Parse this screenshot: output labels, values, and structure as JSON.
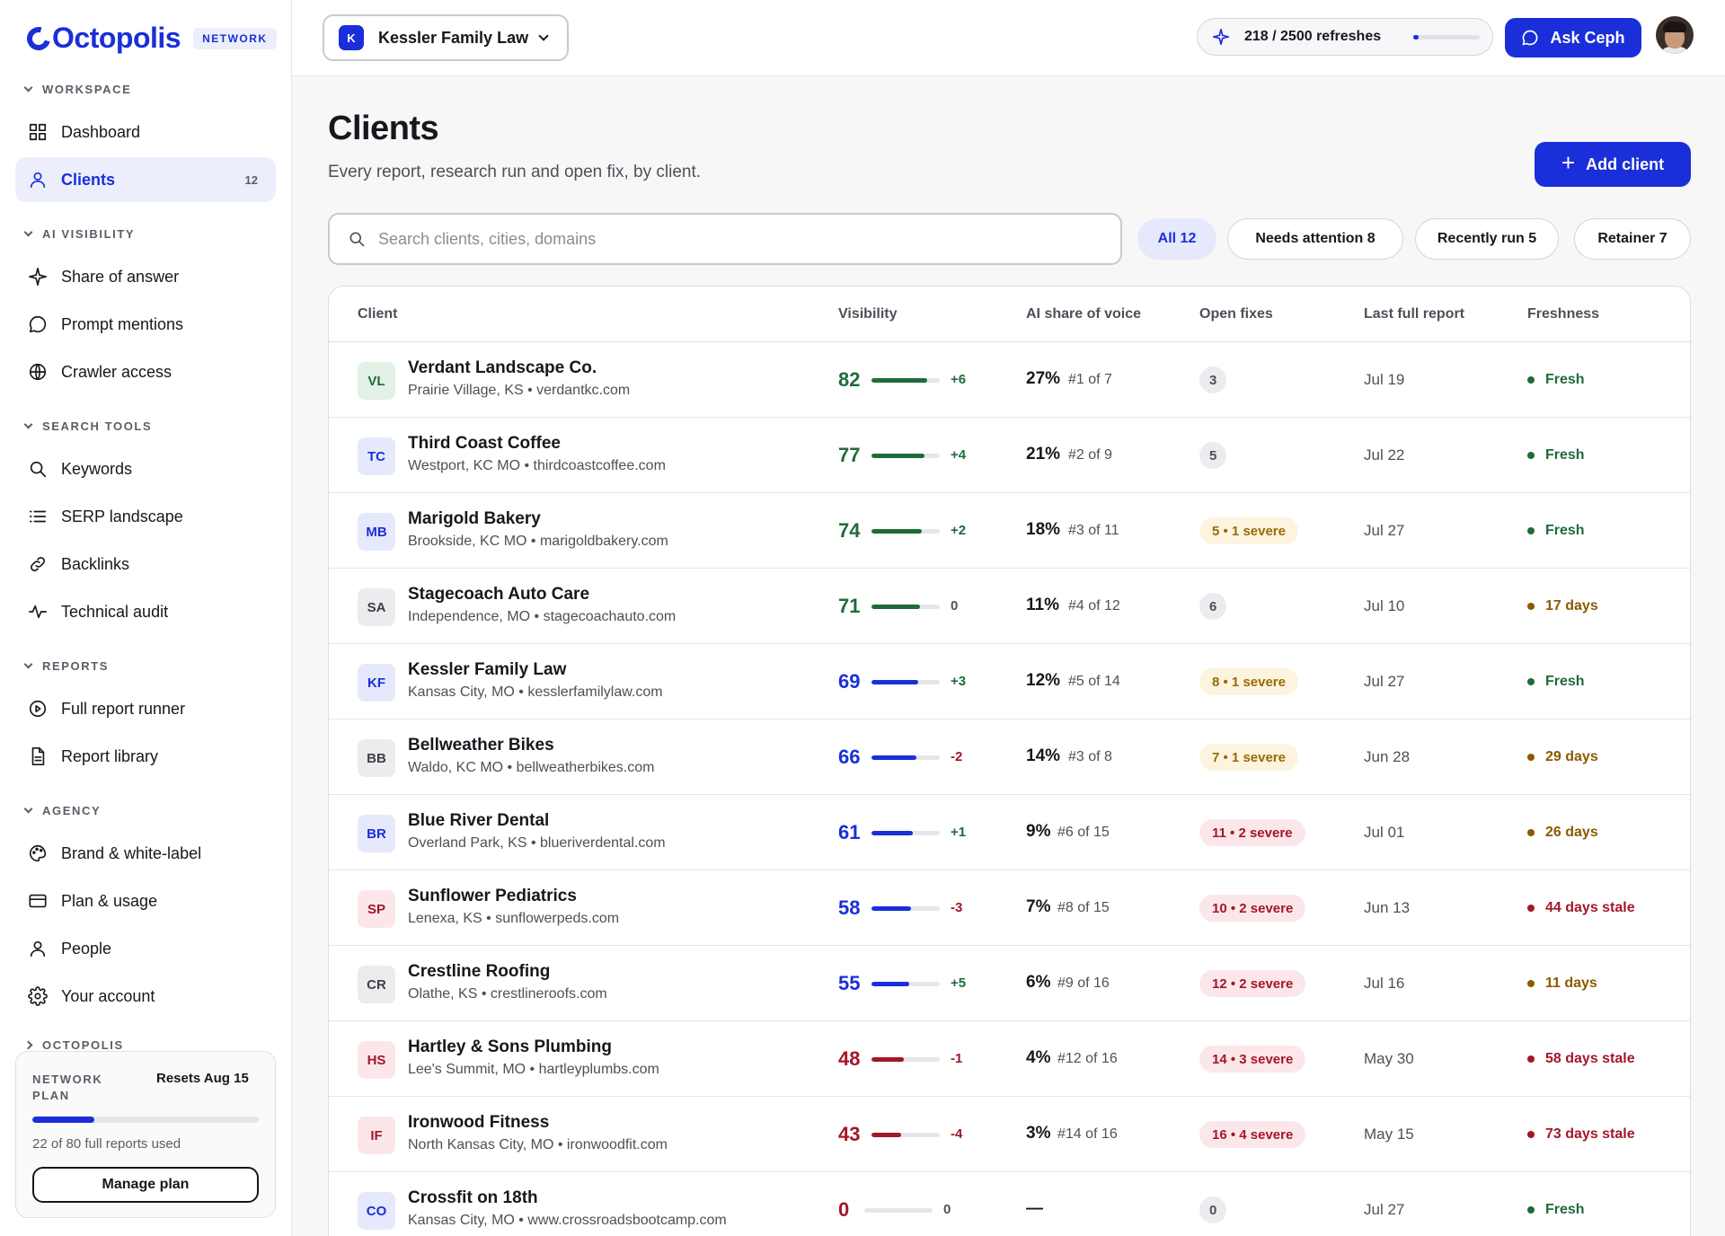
{
  "app": {
    "name": "Octopolis",
    "plan_badge": "NETWORK"
  },
  "sidebar": {
    "sections": [
      {
        "label": "WORKSPACE",
        "items": [
          {
            "label": "Dashboard",
            "icon": "grid-icon"
          },
          {
            "label": "Clients",
            "icon": "user-icon",
            "count": "12",
            "active": true
          }
        ]
      },
      {
        "label": "AI VISIBILITY",
        "items": [
          {
            "label": "Share of answer",
            "icon": "sparkle-icon"
          },
          {
            "label": "Prompt mentions",
            "icon": "chat-bubble-icon"
          },
          {
            "label": "Crawler access",
            "icon": "globe-icon"
          }
        ]
      },
      {
        "label": "SEARCH TOOLS",
        "items": [
          {
            "label": "Keywords",
            "icon": "search-icon"
          },
          {
            "label": "SERP landscape",
            "icon": "list-icon"
          },
          {
            "label": "Backlinks",
            "icon": "link-icon"
          },
          {
            "label": "Technical audit",
            "icon": "pulse-icon"
          }
        ]
      },
      {
        "label": "REPORTS",
        "items": [
          {
            "label": "Full report runner",
            "icon": "play-circle-icon"
          },
          {
            "label": "Report library",
            "icon": "document-icon"
          }
        ]
      },
      {
        "label": "AGENCY",
        "items": [
          {
            "label": "Brand & white-label",
            "icon": "palette-icon"
          },
          {
            "label": "Plan & usage",
            "icon": "credit-card-icon"
          },
          {
            "label": "People",
            "icon": "user-icon"
          },
          {
            "label": "Your account",
            "icon": "gear-icon"
          }
        ]
      }
    ],
    "collapsed_section": "OCTOPOLIS",
    "plan_card": {
      "label": "NETWORK PLAN",
      "resets": "Resets Aug 15",
      "used_text": "22 of 80 full reports used",
      "used_fraction": 0.275,
      "button": "Manage plan"
    }
  },
  "topbar": {
    "client_initial": "K",
    "client_name": "Kessler Family Law",
    "refreshes": "218 / 2500 refreshes",
    "refresh_fraction": 0.087,
    "ask_label": "Ask Ceph"
  },
  "page": {
    "title": "Clients",
    "subtitle": "Every report, research run and open fix, by client.",
    "add_button": "Add client",
    "search_placeholder": "Search clients, cities, domains",
    "filters": [
      {
        "label": "All 12",
        "active": true
      },
      {
        "label": "Needs attention 8"
      },
      {
        "label": "Recently run 5"
      },
      {
        "label": "Retainer 7"
      }
    ]
  },
  "table": {
    "columns": [
      "Client",
      "Visibility",
      "AI share of voice",
      "Open fixes",
      "Last full report",
      "Freshness"
    ],
    "rows": [
      {
        "initials": "VL",
        "tone": "green",
        "name": "Verdant Landscape Co.",
        "meta": "Prairie Village, KS • verdantkc.com",
        "score": "82",
        "score_value": 82,
        "delta": "+6",
        "share": "27%",
        "rank": "#1 of 7",
        "fixes": "3",
        "fix_tone": "neutral",
        "last": "Jul 19",
        "fresh": "Fresh",
        "fresh_tone": "green"
      },
      {
        "initials": "TC",
        "tone": "blue",
        "name": "Third Coast Coffee",
        "meta": "Westport, KC MO • thirdcoastcoffee.com",
        "score": "77",
        "score_value": 77,
        "delta": "+4",
        "share": "21%",
        "rank": "#2 of 9",
        "fixes": "5",
        "fix_tone": "neutral",
        "last": "Jul 22",
        "fresh": "Fresh",
        "fresh_tone": "green"
      },
      {
        "initials": "MB",
        "tone": "blue",
        "name": "Marigold Bakery",
        "meta": "Brookside, KC MO • marigoldbakery.com",
        "score": "74",
        "score_value": 74,
        "delta": "+2",
        "share": "18%",
        "rank": "#3 of 11",
        "fixes": "5 • 1 severe",
        "fix_tone": "warn",
        "last": "Jul 27",
        "fresh": "Fresh",
        "fresh_tone": "green"
      },
      {
        "initials": "SA",
        "tone": "gray",
        "name": "Stagecoach Auto Care",
        "meta": "Independence, MO • stagecoachauto.com",
        "score": "71",
        "score_value": 71,
        "delta": "0",
        "share": "11%",
        "rank": "#4 of 12",
        "fixes": "6",
        "fix_tone": "neutral",
        "last": "Jul 10",
        "fresh": "17 days",
        "fresh_tone": "amber"
      },
      {
        "initials": "KF",
        "tone": "blue",
        "name": "Kessler Family Law",
        "meta": "Kansas City, MO • kesslerfamilylaw.com",
        "score": "69",
        "score_value": 69,
        "delta": "+3",
        "share": "12%",
        "rank": "#5 of 14",
        "fixes": "8 • 1 severe",
        "fix_tone": "warn",
        "last": "Jul 27",
        "fresh": "Fresh",
        "fresh_tone": "green"
      },
      {
        "initials": "BB",
        "tone": "gray",
        "name": "Bellweather Bikes",
        "meta": "Waldo, KC MO • bellweatherbikes.com",
        "score": "66",
        "score_value": 66,
        "delta": "-2",
        "share": "14%",
        "rank": "#3 of 8",
        "fixes": "7 • 1 severe",
        "fix_tone": "warn",
        "last": "Jun 28",
        "fresh": "29 days",
        "fresh_tone": "amber"
      },
      {
        "initials": "BR",
        "tone": "blue",
        "name": "Blue River Dental",
        "meta": "Overland Park, KS • blueriverdental.com",
        "score": "61",
        "score_value": 61,
        "delta": "+1",
        "share": "9%",
        "rank": "#6 of 15",
        "fixes": "11 • 2 severe",
        "fix_tone": "bad",
        "last": "Jul 01",
        "fresh": "26 days",
        "fresh_tone": "amber"
      },
      {
        "initials": "SP",
        "tone": "red",
        "name": "Sunflower Pediatrics",
        "meta": "Lenexa, KS • sunflowerpeds.com",
        "score": "58",
        "score_value": 58,
        "delta": "-3",
        "share": "7%",
        "rank": "#8 of 15",
        "fixes": "10 • 2 severe",
        "fix_tone": "bad",
        "last": "Jun 13",
        "fresh": "44 days stale",
        "fresh_tone": "red"
      },
      {
        "initials": "CR",
        "tone": "gray",
        "name": "Crestline Roofing",
        "meta": "Olathe, KS • crestlineroofs.com",
        "score": "55",
        "score_value": 55,
        "delta": "+5",
        "share": "6%",
        "rank": "#9 of 16",
        "fixes": "12 • 2 severe",
        "fix_tone": "bad",
        "last": "Jul 16",
        "fresh": "11 days",
        "fresh_tone": "amber"
      },
      {
        "initials": "HS",
        "tone": "red",
        "name": "Hartley & Sons Plumbing",
        "meta": "Lee's Summit, MO • hartleyplumbs.com",
        "score": "48",
        "score_value": 48,
        "delta": "-1",
        "share": "4%",
        "rank": "#12 of 16",
        "fixes": "14 • 3 severe",
        "fix_tone": "bad",
        "last": "May 30",
        "fresh": "58 days stale",
        "fresh_tone": "red"
      },
      {
        "initials": "IF",
        "tone": "red",
        "name": "Ironwood Fitness",
        "meta": "North Kansas City, MO • ironwoodfit.com",
        "score": "43",
        "score_value": 43,
        "delta": "-4",
        "share": "3%",
        "rank": "#14 of 16",
        "fixes": "16 • 4 severe",
        "fix_tone": "bad",
        "last": "May 15",
        "fresh": "73 days stale",
        "fresh_tone": "red"
      },
      {
        "initials": "CO",
        "tone": "blue",
        "name": "Crossfit on 18th",
        "meta": "Kansas City, MO • www.crossroadsbootcamp.com",
        "score": "0",
        "score_value": 0,
        "delta": "0",
        "share": "—",
        "rank": "",
        "fixes": "0",
        "fix_tone": "neutral",
        "last": "Jul 27",
        "fresh": "Fresh",
        "fresh_tone": "green"
      }
    ]
  },
  "colors": {
    "accent": "#1a2fd9",
    "score_green": "#1f6b3a",
    "score_blue": "#1a2fd9",
    "score_red": "#a3172a",
    "fresh_green": "#1f6b3a",
    "fresh_amber": "#8a5a00",
    "fresh_red": "#a3172a"
  }
}
